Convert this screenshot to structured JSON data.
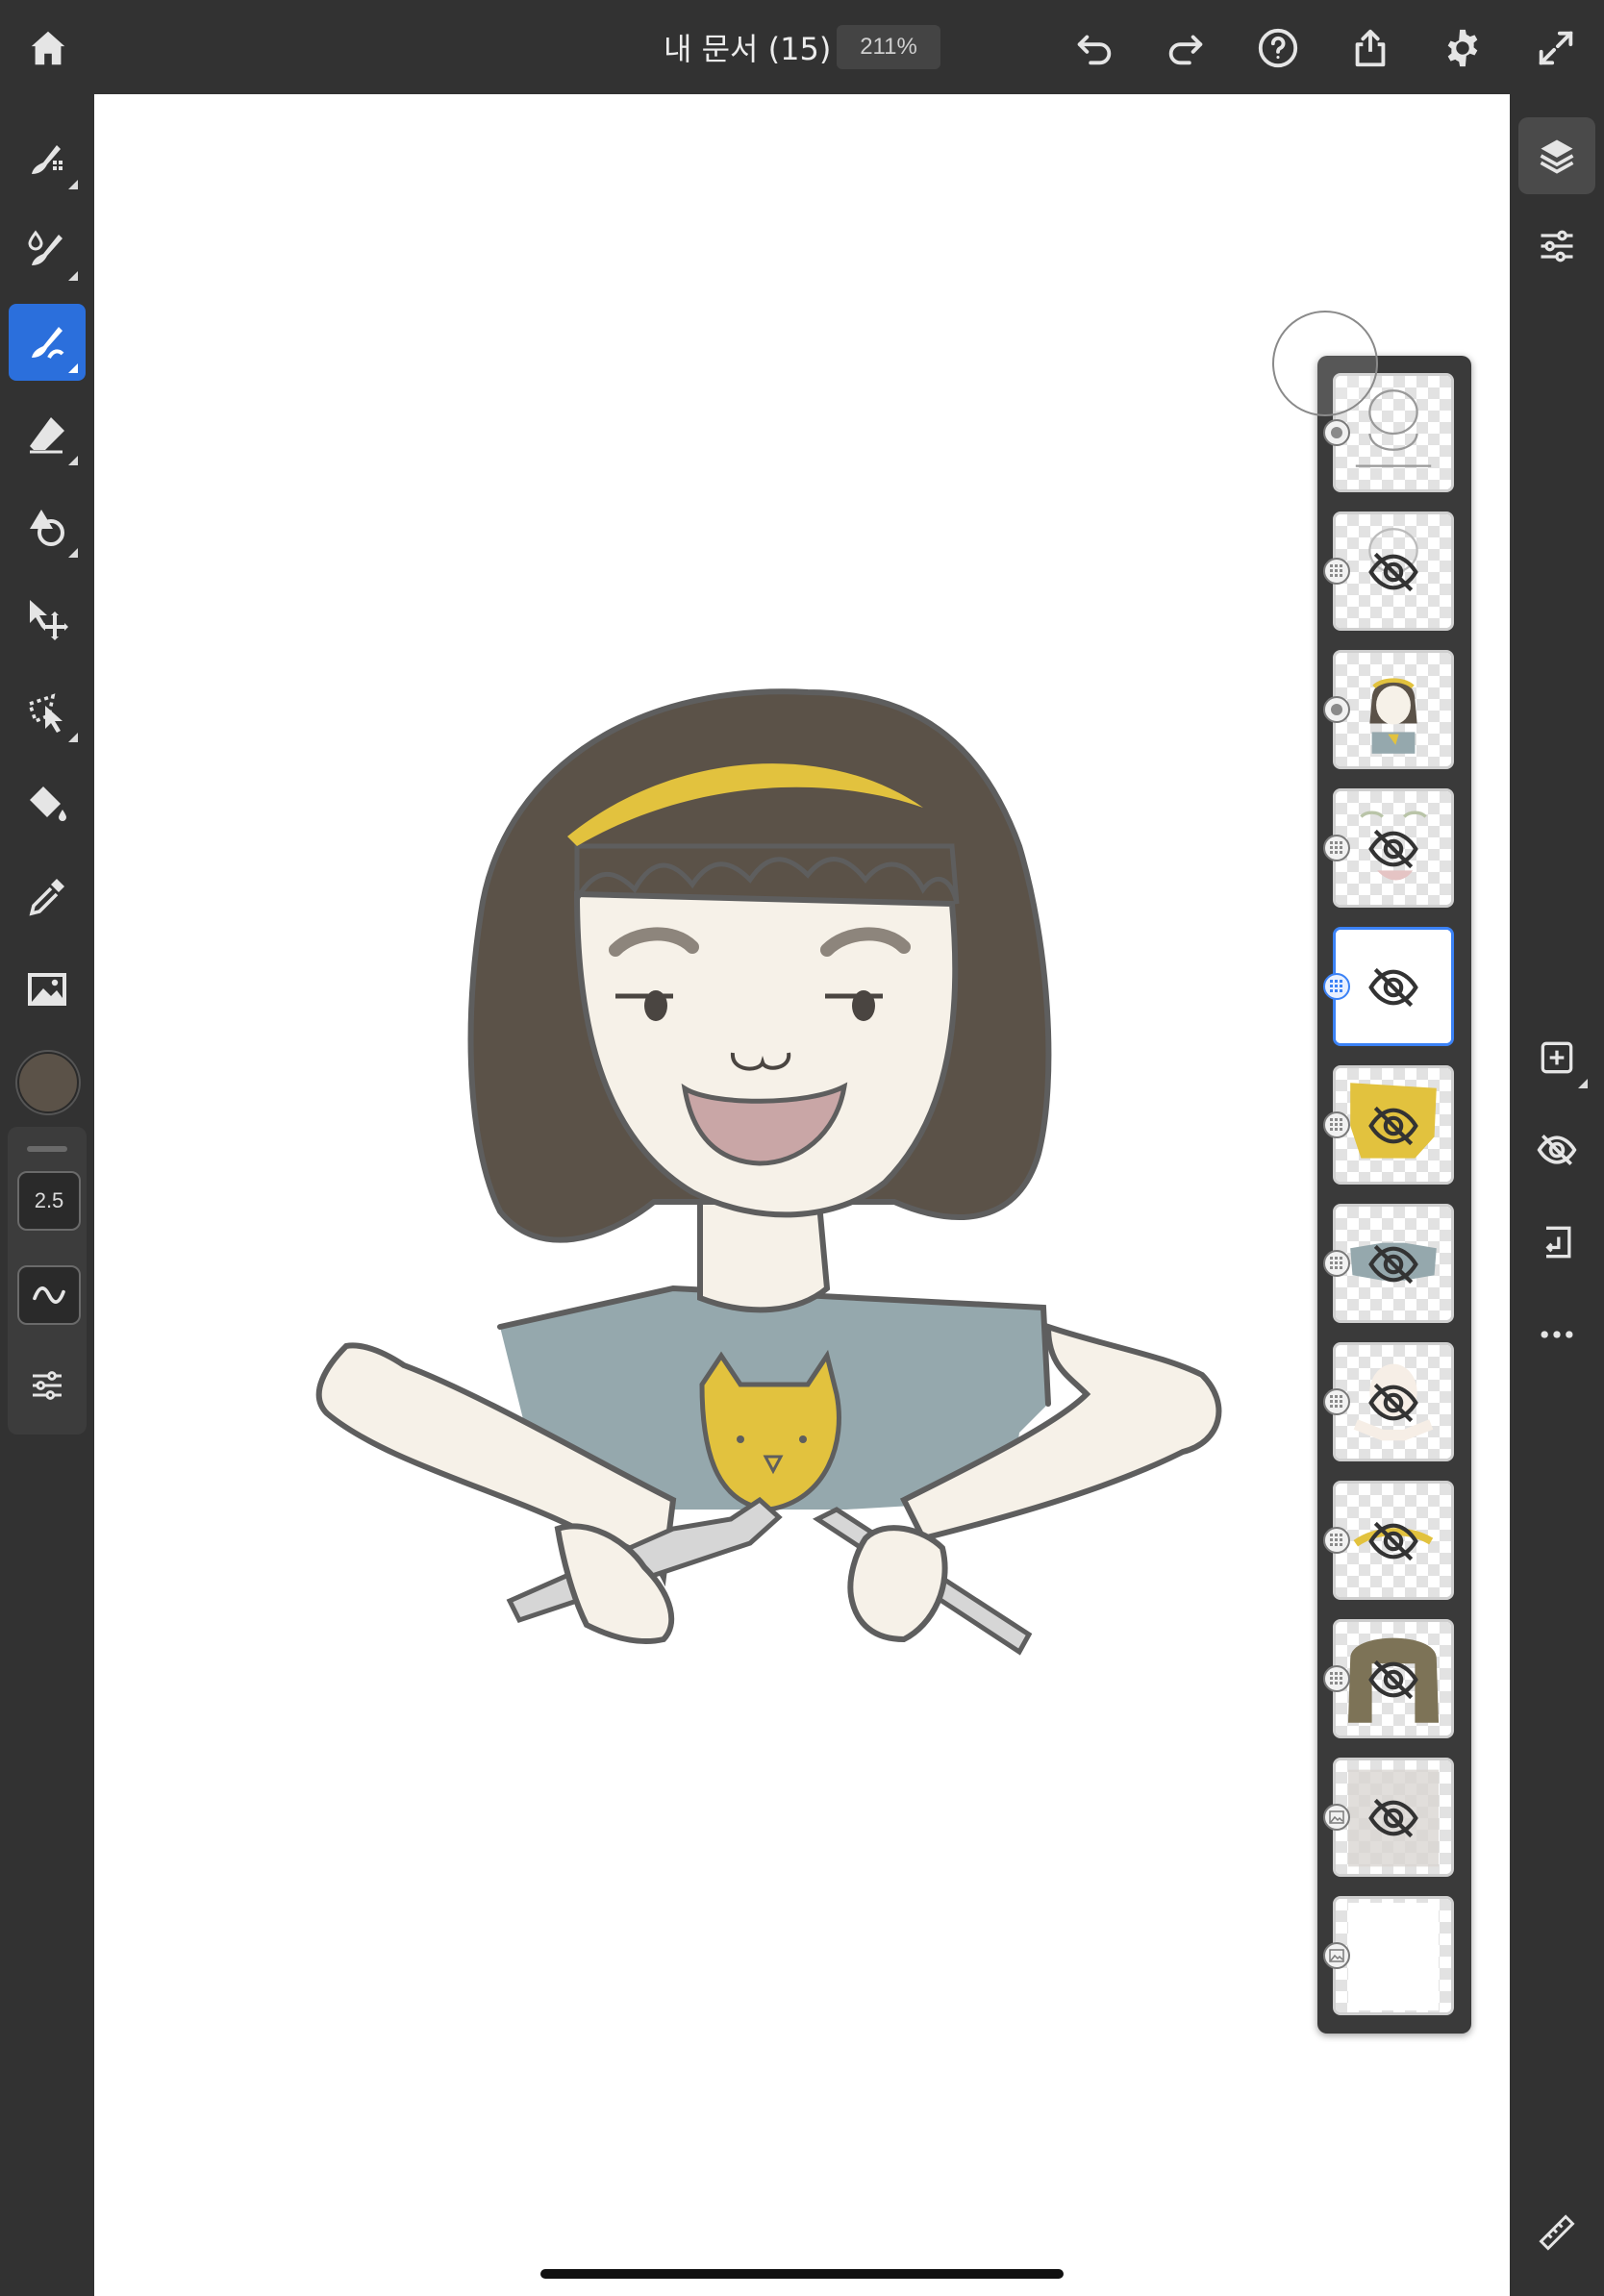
{
  "document": {
    "title": "내 문서 (15)",
    "zoom": "211%"
  },
  "toolbar": {
    "icons": [
      "home-icon",
      "undo-icon",
      "redo-icon",
      "help-icon",
      "share-icon",
      "settings-icon",
      "fullscreen-icon"
    ]
  },
  "tools": [
    "pixel-brush-icon",
    "live-brush-icon",
    "vector-brush-icon",
    "eraser-icon",
    "shape-icon",
    "move-icon",
    "selection-icon",
    "fill-icon",
    "eyedropper-icon",
    "image-icon"
  ],
  "active_tool": "vector-brush-icon",
  "current_color": "#5b5248",
  "brush": {
    "size": "2.5"
  },
  "right_tools": [
    "layers-icon",
    "layer-properties-icon",
    "add-layer-icon",
    "hide-layer-icon",
    "merge-down-icon",
    "more-icon",
    "ruler-icon"
  ],
  "layers": [
    {
      "type": "vector",
      "visible": true,
      "content": "sketch"
    },
    {
      "type": "pixel",
      "visible": false,
      "content": "sketch"
    },
    {
      "type": "vector",
      "visible": true,
      "content": "girl"
    },
    {
      "type": "pixel",
      "visible": false,
      "content": "face"
    },
    {
      "type": "pixel",
      "visible": false,
      "content": "empty",
      "selected": true
    },
    {
      "type": "pixel",
      "visible": false,
      "content": "yellow"
    },
    {
      "type": "pixel",
      "visible": false,
      "content": "shirt"
    },
    {
      "type": "pixel",
      "visible": false,
      "content": "skin"
    },
    {
      "type": "pixel",
      "visible": false,
      "content": "headband"
    },
    {
      "type": "pixel",
      "visible": false,
      "content": "hair"
    },
    {
      "type": "image",
      "visible": false,
      "content": "photo"
    },
    {
      "type": "image",
      "visible": true,
      "content": "white"
    }
  ]
}
